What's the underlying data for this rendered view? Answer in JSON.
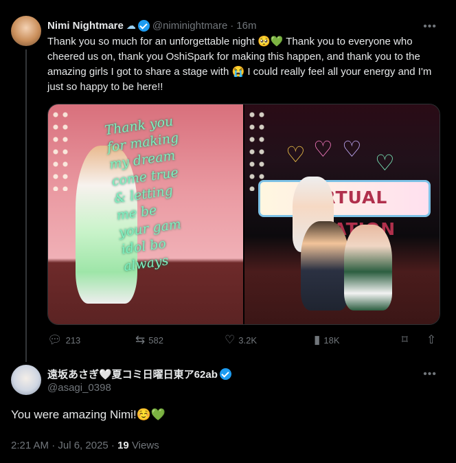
{
  "tweet": {
    "author_name": "Nimi Nightmare",
    "author_handle": "@niminightmare",
    "time": "16m",
    "text": "Thank you so much for an unforgettable night 🥺💚 Thank you to everyone who cheered us on, thank you OshiSpark for making this happen, and thank you to the amazing girls I got to share a stage with 😭 I could really feel all your energy and I'm just so happy to be here!!",
    "images": {
      "left_handwritten": "Thank you\nfor making\nmy dream\ncome true\n& letting\nme be\nyour gam\nidol bo\nalways",
      "right_sign": "VIRTUAL VACATION"
    },
    "actions": {
      "replies": "213",
      "reposts": "582",
      "likes": "3.2K",
      "views": "18K"
    }
  },
  "reply": {
    "author_name": "遠坂あさぎ🤍夏コミ日曜日東ア62ab",
    "author_handle": "@asagi_0398",
    "text": "You were amazing Nimi!☺️💚",
    "timestamp": "2:21 AM · Jul 6, 2025 ·",
    "views_count": "19",
    "views_label": "Views"
  },
  "icons": [
    "cloud-icon",
    "verified-badge-icon",
    "more-icon",
    "reply-icon",
    "repost-icon",
    "like-icon",
    "views-icon",
    "bookmark-icon",
    "share-icon"
  ],
  "colors": {
    "accent": "#1d9bf0",
    "muted": "#71767b",
    "text": "#e7e9ea",
    "background": "#000000"
  }
}
